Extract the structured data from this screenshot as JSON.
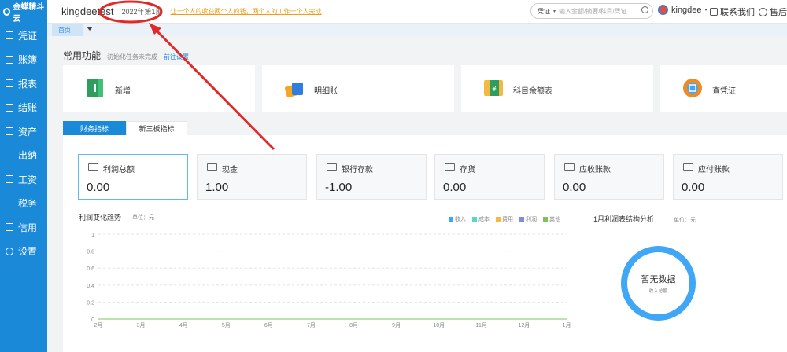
{
  "brand": "kingdeetest",
  "period": "2022年第1期",
  "notice": "让一个人的收获两个人的钱，两个人的工作一个人完成",
  "sidebar": {
    "logo": "金蝶精斗云",
    "items": [
      {
        "label": "凭证"
      },
      {
        "label": "账簿"
      },
      {
        "label": "报表"
      },
      {
        "label": "结账"
      },
      {
        "label": "资产"
      },
      {
        "label": "出纳"
      },
      {
        "label": "工资"
      },
      {
        "label": "税务"
      },
      {
        "label": "信用"
      },
      {
        "label": "设置"
      }
    ]
  },
  "search": {
    "type": "凭证",
    "placeholder": "输入金额/摘要/科目/凭证"
  },
  "user": {
    "name": "kingdee"
  },
  "header_links": {
    "contact": "联系我们",
    "after_sales": "售后"
  },
  "page_tab": "首页",
  "section": {
    "title": "常用功能",
    "note": "初始化任务未完成",
    "link": "前往设置"
  },
  "functions": [
    {
      "label": "新增"
    },
    {
      "label": "明细账"
    },
    {
      "label": "科目余额表"
    },
    {
      "label": "查凭证"
    }
  ],
  "tabs": {
    "active": "财务指标",
    "inactive": "新三板指标"
  },
  "metrics": [
    {
      "label": "利润总额",
      "value": "0.00"
    },
    {
      "label": "现金",
      "value": "1.00"
    },
    {
      "label": "银行存款",
      "value": "-1.00"
    },
    {
      "label": "存货",
      "value": "0.00"
    },
    {
      "label": "应收账款",
      "value": "0.00"
    },
    {
      "label": "应付账款",
      "value": "0.00"
    }
  ],
  "colors": {
    "accent": "#1989d8",
    "annotation": "#e02a2a"
  },
  "chart_data": [
    {
      "type": "line",
      "title": "利润变化趋势",
      "unit": "单位：元",
      "categories": [
        "2月",
        "3月",
        "4月",
        "5月",
        "6月",
        "7月",
        "8月",
        "9月",
        "10月",
        "11月",
        "12月",
        "1月"
      ],
      "ylim": [
        0,
        1
      ],
      "yticks": [
        "1",
        "0.8",
        "0.6",
        "0.4",
        "0.2",
        "0"
      ],
      "legend": [
        {
          "name": "收入",
          "color": "#3fa7f5"
        },
        {
          "name": "成本",
          "color": "#5cd6c6"
        },
        {
          "name": "费用",
          "color": "#f5b941"
        },
        {
          "name": "利润",
          "color": "#7b8de0"
        },
        {
          "name": "其他",
          "color": "#7cc45a"
        }
      ],
      "series": [
        {
          "name": "利润",
          "values": [
            0,
            0,
            0,
            0,
            0,
            0,
            0,
            0,
            0,
            0,
            0,
            0
          ]
        }
      ],
      "grid": true,
      "legend_position": "top-right"
    },
    {
      "type": "pie",
      "title": "1月利润表结构分析",
      "unit": "单位：元",
      "empty_text": "暂无数据",
      "center_label": "收入总额"
    }
  ]
}
